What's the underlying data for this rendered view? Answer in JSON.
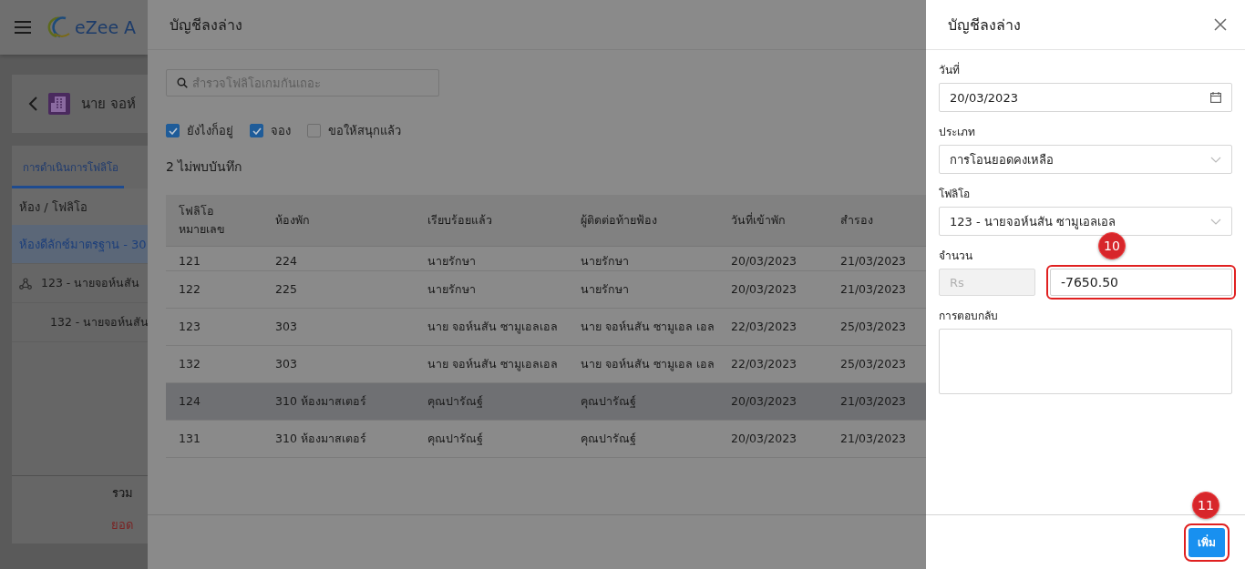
{
  "app": {
    "logo_text": "eZee A",
    "guest_title": "นาย จอห์",
    "tabs": [
      {
        "label": "การดำเนินการโฟลิโอ",
        "selected": true
      }
    ],
    "list_header": "ห้อง / โฟลิโอ",
    "rooms": [
      {
        "kind": "room",
        "label": "ห้องดีลักซ์มาตรฐาน - 30",
        "selected": true
      },
      {
        "kind": "master",
        "label": "123 - นายจอห์นสัน",
        "selected": false
      },
      {
        "kind": "folio",
        "label": "132 - นายจอห์นสัน",
        "selected": false
      }
    ],
    "total_label": "รวม",
    "balance_label": "ยอด"
  },
  "folio_drawer": {
    "title": "บัญชีลงล่าง",
    "search": {
      "placeholder": "สำรวจโฟลิโอเกมกันเถอะ"
    },
    "filters": [
      {
        "label": "ยังไงก็อยู่",
        "checked": true
      },
      {
        "label": "จอง",
        "checked": true
      },
      {
        "label": "ขอให้สนุกแล้ว",
        "checked": false
      }
    ],
    "record_count": "2 ไม่พบบันทึก",
    "table": {
      "columns": [
        "โฟลิโอ หมายเลข",
        "ห้องพัก",
        "เรียบร้อยแล้ว",
        "ผู้ติดต่อท้ายฟ้อง",
        "วันที่เข้าพัก",
        "สำรอง"
      ],
      "rows": [
        {
          "cells": [
            "121",
            "224",
            "นายรักษา",
            "นายรักษา",
            "20/03/2023",
            "21/03/2023"
          ],
          "selected": false
        },
        {
          "cells": [
            "122",
            "225",
            "นายรักษา",
            "นายรักษา",
            "20/03/2023",
            "21/03/2023"
          ],
          "selected": false
        },
        {
          "cells": [
            "123",
            "303",
            "นาย จอห์นสัน ซามูเอลเอล",
            "นาย จอห์นสัน ซามูเอล เอล",
            "22/03/2023",
            "25/03/2023"
          ],
          "selected": false
        },
        {
          "cells": [
            "132",
            "303",
            "นาย จอห์นสัน ซามูเอลเอล",
            "นาย จอห์นสัน ซามูเอล เอล",
            "22/03/2023",
            "25/03/2023"
          ],
          "selected": false
        },
        {
          "cells": [
            "124",
            "310 ห้องมาสเตอร์",
            "คุณปารัณฐ์",
            "คุณปารัณฐ์",
            "20/03/2023",
            "21/03/2023"
          ],
          "selected": true
        },
        {
          "cells": [
            "131",
            "310 ห้องมาสเตอร์",
            "คุณปารัณฐ์",
            "คุณปารัณฐ์",
            "20/03/2023",
            "21/03/2023"
          ],
          "selected": false
        }
      ]
    }
  },
  "form_drawer": {
    "title": "บัญชีลงล่าง",
    "date": {
      "label": "วันที่",
      "value": "20/03/2023"
    },
    "type": {
      "label": "ประเภท",
      "value": "การโอนยอดคงเหลือ"
    },
    "folio": {
      "label": "โฟลิโอ",
      "value": "123 - นายจอห์นสัน ซามูเอลเอล"
    },
    "amount": {
      "label": "จำนวน",
      "currency": "Rs",
      "value": "-7650.50",
      "marker": "10"
    },
    "comment": {
      "label": "การตอบกลับ"
    },
    "add_button": {
      "label": "เพิ่ม",
      "marker": "11"
    }
  }
}
